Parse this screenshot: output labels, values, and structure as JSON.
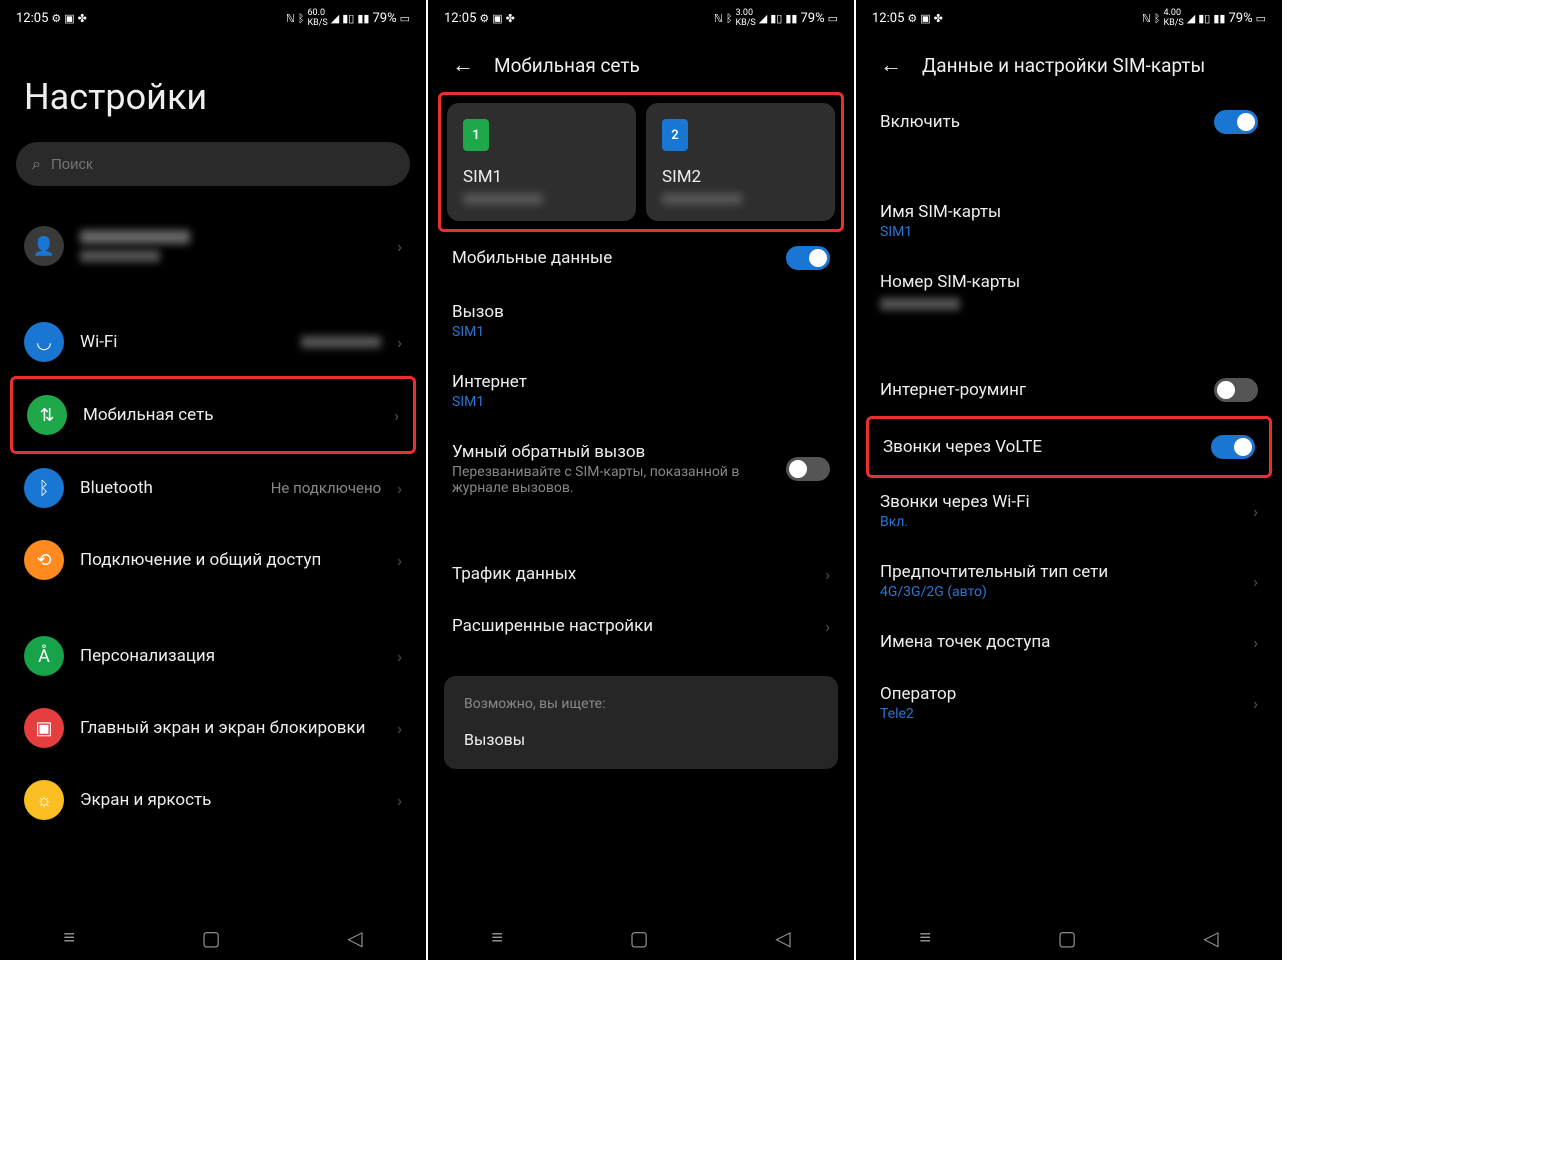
{
  "status": {
    "time": "12:05",
    "battery": "79%",
    "net1": "60.0",
    "net2": "3.00",
    "net3": "4.00",
    "unit": "KB/S"
  },
  "screen1": {
    "title": "Настройки",
    "search_placeholder": "Поиск",
    "wifi": "Wi-Fi",
    "mobile": "Мобильная сеть",
    "bluetooth": "Bluetooth",
    "bluetooth_state": "Не подключено",
    "share": "Подключение и общий доступ",
    "personalization": "Персонализация",
    "homescreen": "Главный экран и экран блокировки",
    "display": "Экран и яркость"
  },
  "screen2": {
    "title": "Мобильная сеть",
    "sim1": "SIM1",
    "sim2": "SIM2",
    "mobile_data": "Мобильные данные",
    "call": "Вызов",
    "call_sim": "SIM1",
    "internet": "Интернет",
    "internet_sim": "SIM1",
    "smart_callback": "Умный обратный вызов",
    "smart_callback_desc": "Перезванивайте с SIM-карты, показанной в журнале вызовов.",
    "traffic": "Трафик данных",
    "advanced": "Расширенные настройки",
    "suggest_label": "Возможно, вы ищете:",
    "suggest_item": "Вызовы"
  },
  "screen3": {
    "title": "Данные и настройки SIM-карты",
    "enable": "Включить",
    "sim_name": "Имя SIM-карты",
    "sim_name_val": "SIM1",
    "sim_number": "Номер SIM-карты",
    "roaming": "Интернет-роуминг",
    "volte": "Звонки через VoLTE",
    "wifi_call": "Звонки через Wi-Fi",
    "wifi_call_val": "Вкл.",
    "net_type": "Предпочтительный тип сети",
    "net_type_val": "4G/3G/2G (авто)",
    "apn": "Имена точек доступа",
    "operator": "Оператор",
    "operator_val": "Tele2"
  }
}
